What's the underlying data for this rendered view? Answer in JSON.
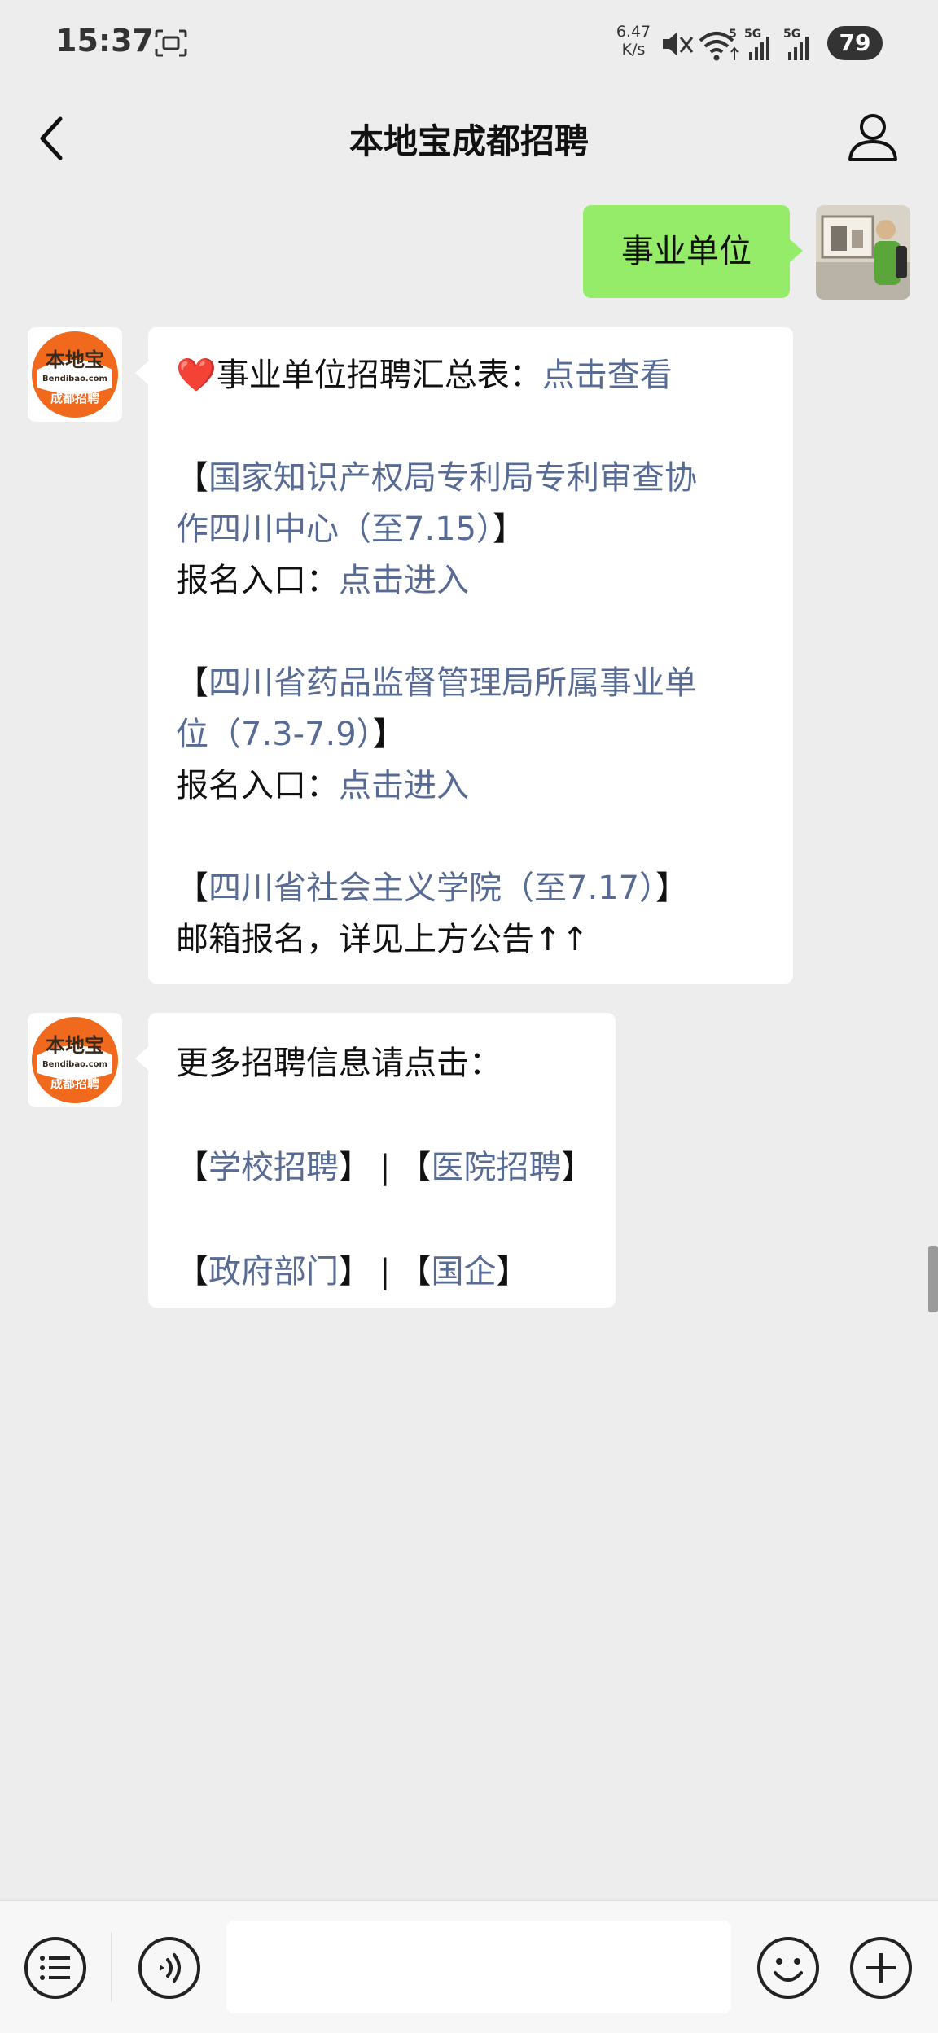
{
  "status_bar": {
    "time": "15:37",
    "net_speed_value": "6.47",
    "net_speed_unit": "K/s",
    "wifi_badge": "5",
    "sim1_badge": "5G",
    "sim2_badge": "5G",
    "battery": "79",
    "icons": [
      "screenshot-icon",
      "mute-icon",
      "wifi-icon",
      "signal-icon",
      "signal-icon",
      "battery-icon"
    ]
  },
  "header": {
    "title": "本地宝成都招聘",
    "back_icon": "chevron-left-icon",
    "profile_icon": "person-icon"
  },
  "bot_avatar": {
    "brand": "本地宝",
    "domain": "Bendibao.com",
    "city": "成都招聘",
    "colors": {
      "orange": "#f0691c",
      "dark": "#3a2a1c"
    }
  },
  "messages": {
    "user_message": "事业单位",
    "bot_message_1": {
      "line1_text": "❤️事业单位招聘汇总表：",
      "line1_link": "点击查看",
      "entry1_open": "【",
      "entry1_title_line1": "国家知识产权局专利局专利审查协",
      "entry1_title_line2": "作四川中心（至7.15）",
      "entry1_close": "】",
      "entry1_label": "报名入口：",
      "entry1_link": "点击进入",
      "entry2_open": "【",
      "entry2_title_line1": "四川省药品监督管理局所属事业单",
      "entry2_title_line2": "位（7.3-7.9）",
      "entry2_close": "】",
      "entry2_label": "报名入口：",
      "entry2_link": "点击进入",
      "entry3_open": "【",
      "entry3_title": "四川省社会主义学院（至7.17）",
      "entry3_close": "】",
      "entry3_note": "邮箱报名，详见上方公告↑↑"
    },
    "bot_message_2": {
      "intro": "更多招聘信息请点击：",
      "link_school": "学校招聘",
      "link_hospital": "医院招聘",
      "link_government": "政府部门",
      "link_soe": "国企",
      "open_bracket": "【",
      "close_bracket": "】",
      "separator": "|"
    }
  },
  "input_bar": {
    "menu_icon": "list-menu-icon",
    "voice_icon": "voice-icon",
    "input_value": "",
    "emoji_icon": "smiley-icon",
    "add_icon": "plus-icon"
  },
  "colors": {
    "background": "#ededed",
    "user_bubble": "#95ec69",
    "bot_bubble": "#ffffff",
    "link": "#576b95"
  }
}
